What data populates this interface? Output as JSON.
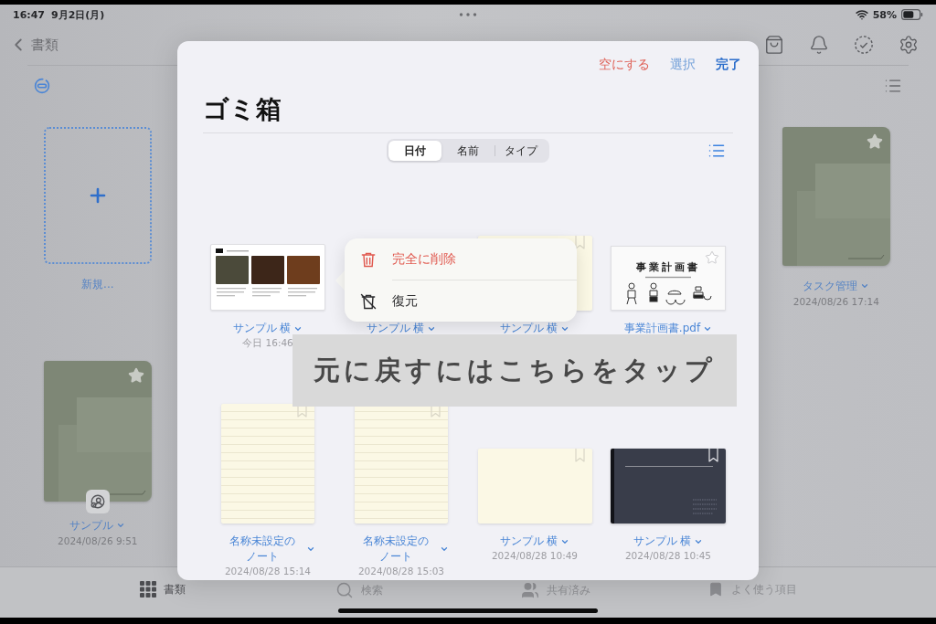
{
  "status_bar": {
    "time": "16:47",
    "date": "9月2日(月)",
    "battery": "58%"
  },
  "nav": {
    "back_label": "書類"
  },
  "library": {
    "new_item": {
      "label": "新規..."
    },
    "items": [
      {
        "title": "タスク管理",
        "date": "2024/08/26 17:14",
        "shared": false
      },
      {
        "title": "サンプル",
        "date": "2024/08/26 9:51",
        "shared": true
      }
    ]
  },
  "trash_dialog": {
    "actions": [
      {
        "label": "空にする",
        "kind": "destructive"
      },
      {
        "label": "選択",
        "kind": "plain"
      },
      {
        "label": "完了",
        "kind": "done"
      }
    ],
    "title": "ゴミ箱",
    "sort_tabs": [
      {
        "label": "日付",
        "selected": true
      },
      {
        "label": "名前",
        "selected": false
      },
      {
        "label": "タイプ",
        "selected": false
      }
    ],
    "items": [
      {
        "title": "サンプル 横",
        "date": "今日 16:46",
        "kind": "photo-document"
      },
      {
        "title": "サンプル 横"
      },
      {
        "title": "サンプル 横",
        "kind": "plain-landscape"
      },
      {
        "title": "事業計画書.pdf",
        "kind": "pdf",
        "thumbnail_title": "事業計画書"
      },
      {
        "title": "名称未設定のノート",
        "date": "2024/08/28 15:14",
        "kind": "lined-portrait"
      },
      {
        "title": "名称未設定のノート",
        "date": "2024/08/28 15:03",
        "kind": "lined-portrait"
      },
      {
        "title": "サンプル 横",
        "date": "2024/08/28 10:49",
        "kind": "plain-landscape"
      },
      {
        "title": "サンプル 横",
        "date": "2024/08/28 10:45",
        "kind": "dark-landscape"
      }
    ],
    "context_menu": {
      "items": [
        {
          "label": "完全に削除",
          "kind": "delete"
        },
        {
          "label": "復元",
          "kind": "restore"
        }
      ]
    }
  },
  "annotation": {
    "text": "元に戻すにはこちらをタップ"
  },
  "tab_bar": {
    "tabs": [
      {
        "label": "書類",
        "kind": "documents",
        "selected": true
      },
      {
        "label": "検索",
        "kind": "search",
        "selected": false
      },
      {
        "label": "共有済み",
        "kind": "shared",
        "selected": false
      },
      {
        "label": "よく使う項目",
        "kind": "favorites",
        "selected": false
      }
    ]
  }
}
